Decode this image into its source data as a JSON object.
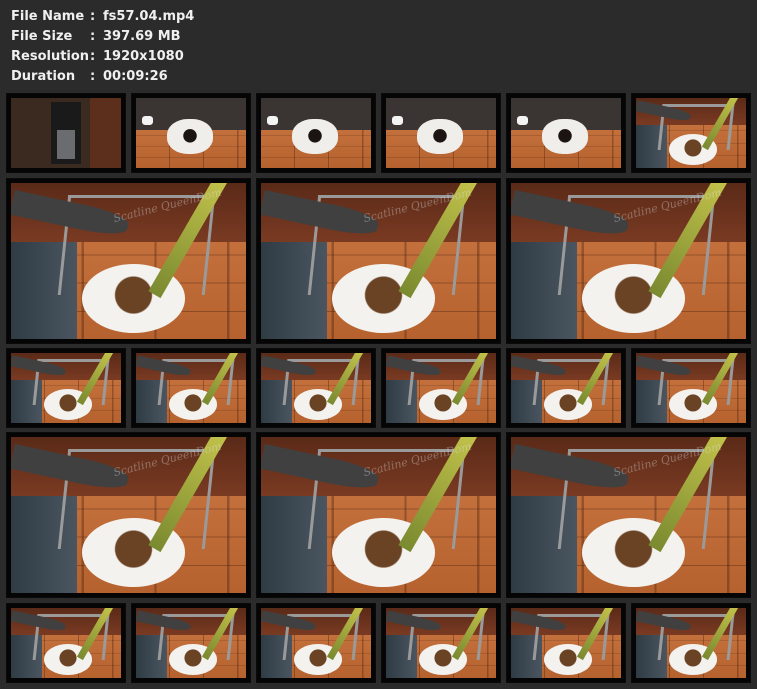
{
  "info": {
    "rows": [
      {
        "key": "File Name",
        "sep": ":",
        "value": "fs57.04.mp4"
      },
      {
        "key": "File Size",
        "sep": ":",
        "value": "397.69 MB"
      },
      {
        "key": "Resolution",
        "sep": ":",
        "value": "1920x1080"
      },
      {
        "key": "Duration",
        "sep": ":",
        "value": "00:09:26"
      }
    ]
  },
  "watermark_text": "Scatline QueenDom",
  "colors": {
    "background": "#2b2b2b",
    "text": "#f0f0f0",
    "thumb_border": "#0a0a0a"
  }
}
